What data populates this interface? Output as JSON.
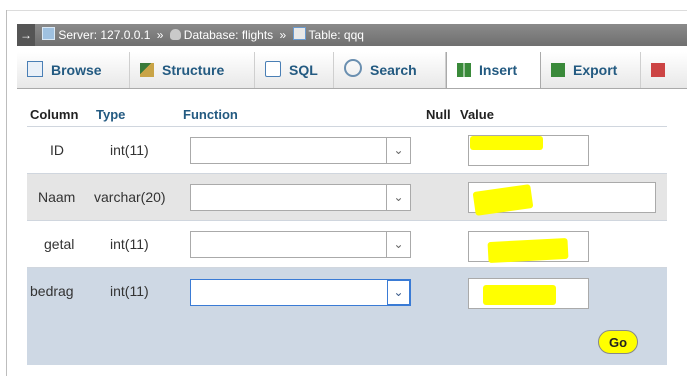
{
  "breadcrumb": {
    "arrow": "→",
    "server": "Server: 127.0.0.1",
    "sep1": "»",
    "database": "Database: flights",
    "sep2": "»",
    "table": "Table: qqq"
  },
  "tabs": [
    {
      "label": "Browse",
      "icon": "browse-icon"
    },
    {
      "label": "Structure",
      "icon": "structure-icon"
    },
    {
      "label": "SQL",
      "icon": "sql-icon"
    },
    {
      "label": "Search",
      "icon": "search-icon"
    },
    {
      "label": "Insert",
      "icon": "insert-icon",
      "active": true
    },
    {
      "label": "Export",
      "icon": "export-icon"
    }
  ],
  "headers": {
    "column": "Column",
    "type": "Type",
    "function": "Function",
    "null": "Null",
    "value": "Value"
  },
  "rows": [
    {
      "column": "ID",
      "type": "int(11)",
      "function": "",
      "value": ""
    },
    {
      "column": "Naam",
      "type": "varchar(20)",
      "function": "",
      "value": ""
    },
    {
      "column": "getal",
      "type": "int(11)",
      "function": "",
      "value": ""
    },
    {
      "column": "bedrag",
      "type": "int(11)",
      "function": "",
      "value": ""
    }
  ],
  "go_label": "Go",
  "colors": {
    "highlight": "#ffff00",
    "tab_text": "#235a81",
    "row_highlight": "#ced8e4"
  }
}
